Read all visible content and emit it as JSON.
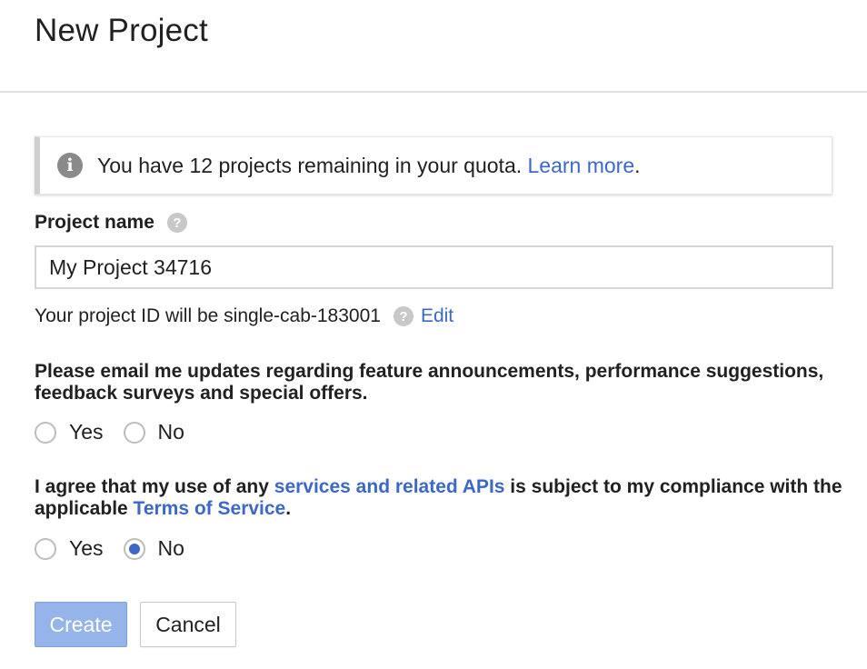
{
  "dialog": {
    "title": "New Project"
  },
  "notice": {
    "icon": "info-icon",
    "text": "You have 12 projects remaining in your quota. ",
    "link": "Learn more",
    "suffix": "."
  },
  "project_name": {
    "label": "Project name",
    "help_icon": "help-icon",
    "value": "My Project 34716"
  },
  "project_id": {
    "text": "Your project ID will be single-cab-183001",
    "edit_link": "Edit"
  },
  "email_updates": {
    "question": "Please email me updates regarding feature announcements, performance suggestions, feedback surveys and special offers.",
    "options": [
      "Yes",
      "No"
    ],
    "selected": null
  },
  "terms": {
    "text_1": "I agree that my use of any ",
    "link_1": "services and related APIs",
    "text_2": " is subject to my compliance with the applicable ",
    "link_2": "Terms of Service",
    "text_3": ".",
    "options": [
      "Yes",
      "No"
    ],
    "selected": "No"
  },
  "actions": {
    "create": "Create",
    "cancel": "Cancel"
  },
  "colors": {
    "link": "#3b68c9",
    "primary_disabled": "#94b4ea",
    "radio_selected": "#3b68c9"
  }
}
